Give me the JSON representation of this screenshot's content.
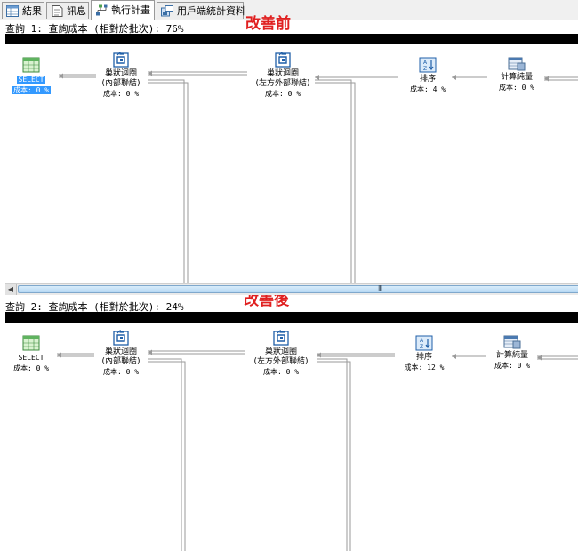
{
  "tabs": [
    {
      "label": "結果",
      "icon": "grid-icon",
      "active": false
    },
    {
      "label": "訊息",
      "icon": "message-icon",
      "active": false
    },
    {
      "label": "執行計畫",
      "icon": "execution-plan-icon",
      "active": true
    },
    {
      "label": "用戶端統計資料",
      "icon": "client-statistics-icon",
      "active": false
    }
  ],
  "annotations": {
    "before": "改善前",
    "after": "改善後"
  },
  "queries": [
    {
      "header": "查詢 1: 查詢成本 (相對於批次): 76%",
      "nodes": [
        {
          "name": "select",
          "title": "SELECT",
          "sub": "",
          "cost": "成本: 0 %",
          "icon": "select-icon",
          "selected": true
        },
        {
          "name": "nested-loops-inner",
          "title": "巢狀迴圈",
          "sub": "(內部聯結)",
          "cost": "成本: 0 %",
          "icon": "nested-loops-icon"
        },
        {
          "name": "nested-loops-left-outer",
          "title": "巢狀迴圈",
          "sub": "(左方外部聯結)",
          "cost": "成本: 0 %",
          "icon": "nested-loops-icon"
        },
        {
          "name": "sort",
          "title": "排序",
          "sub": "",
          "cost": "成本: 4 %",
          "icon": "sort-icon"
        },
        {
          "name": "compute-scalar",
          "title": "計算純量",
          "sub": "",
          "cost": "成本: 0 %",
          "icon": "compute-scalar-icon"
        }
      ]
    },
    {
      "header": "查詢 2: 查詢成本 (相對於批次): 24%",
      "nodes": [
        {
          "name": "select",
          "title": "SELECT",
          "sub": "",
          "cost": "成本: 0 %",
          "icon": "select-icon",
          "selected": false
        },
        {
          "name": "nested-loops-inner",
          "title": "巢狀迴圈",
          "sub": "(內部聯結)",
          "cost": "成本: 0 %",
          "icon": "nested-loops-icon"
        },
        {
          "name": "nested-loops-left-outer",
          "title": "巢狀迴圈",
          "sub": "(左方外部聯結)",
          "cost": "成本: 0 %",
          "icon": "nested-loops-icon"
        },
        {
          "name": "sort",
          "title": "排序",
          "sub": "",
          "cost": "成本: 12 %",
          "icon": "sort-icon"
        },
        {
          "name": "compute-scalar",
          "title": "計算純量",
          "sub": "",
          "cost": "成本: 0 %",
          "icon": "compute-scalar-icon"
        }
      ]
    }
  ],
  "scrollbar": {
    "grip": "III"
  },
  "colors": {
    "annotation": "#e02020",
    "selection": "#3399ff",
    "header_bar": "#000000"
  }
}
